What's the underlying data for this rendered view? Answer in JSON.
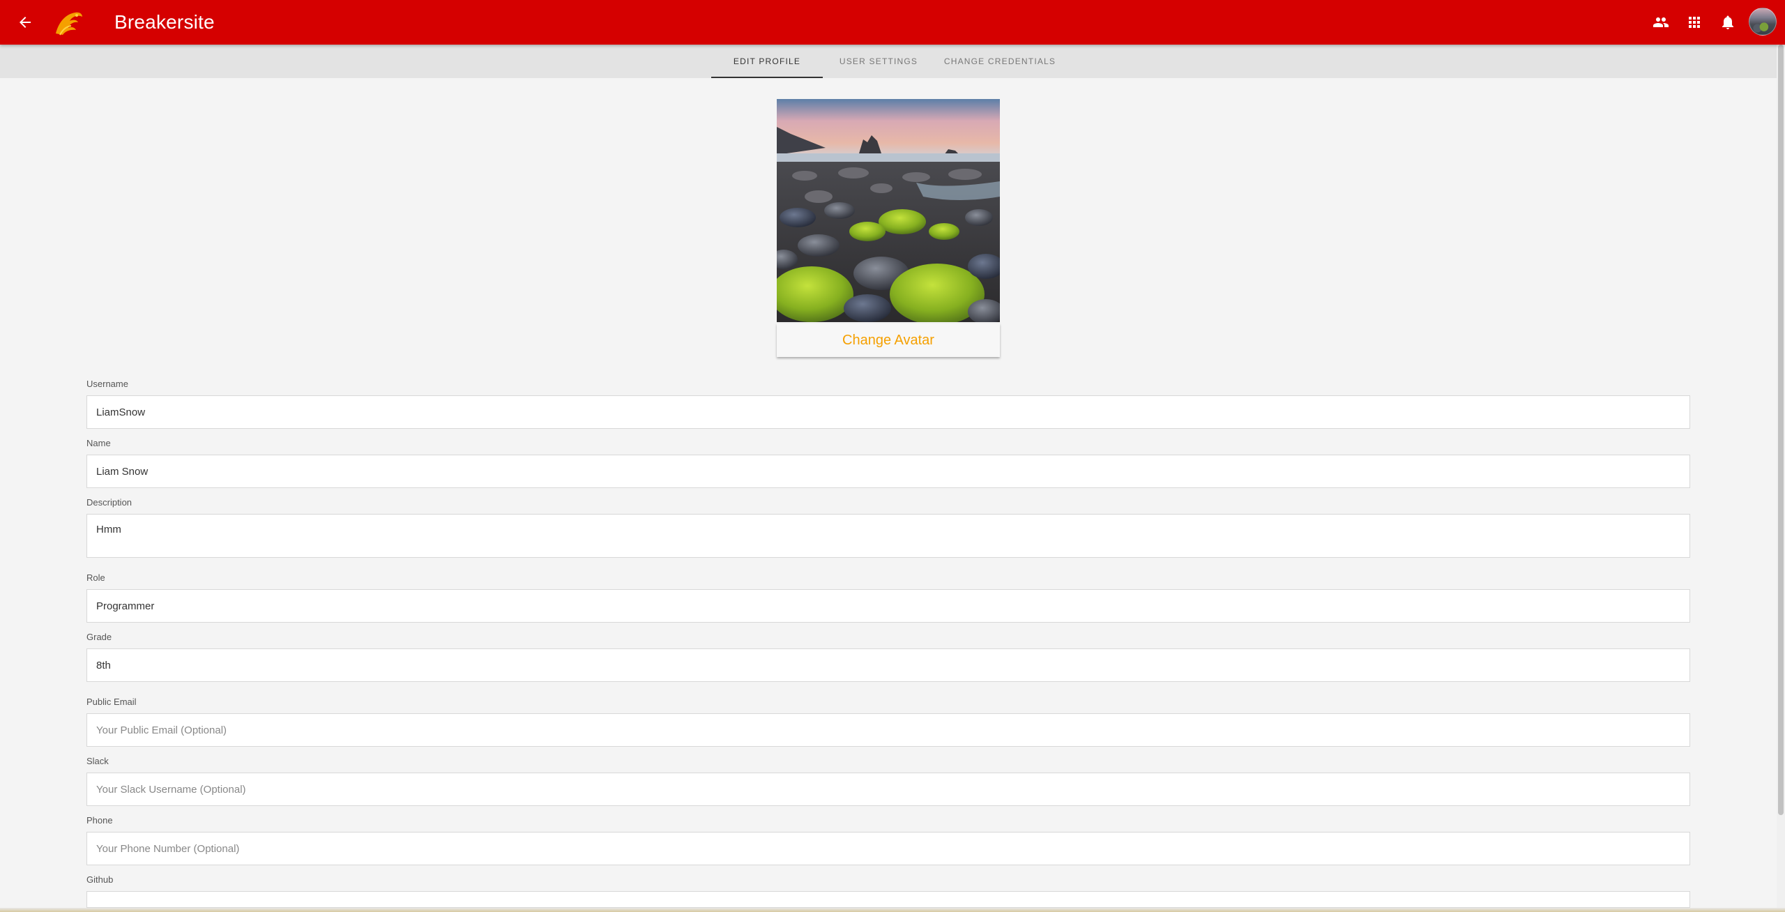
{
  "app": {
    "title": "Breakersite"
  },
  "icons": {
    "back": "arrow-left-icon",
    "logo": "breaker-wave-logo",
    "people": "people-icon",
    "apps": "apps-grid-icon",
    "notifications": "bell-icon",
    "avatar": "user-avatar"
  },
  "colors": {
    "appbar": "#d50000",
    "accent": "#f5a000"
  },
  "tabs": [
    {
      "label": "EDIT PROFILE",
      "active": true
    },
    {
      "label": "USER SETTINGS",
      "active": false
    },
    {
      "label": "CHANGE CREDENTIALS",
      "active": false
    }
  ],
  "avatar": {
    "button_label": "Change Avatar"
  },
  "form": {
    "username": {
      "label": "Username",
      "value": "LiamSnow",
      "placeholder": ""
    },
    "name": {
      "label": "Name",
      "value": "Liam Snow",
      "placeholder": ""
    },
    "description": {
      "label": "Description",
      "value": "Hmm",
      "placeholder": ""
    },
    "role": {
      "label": "Role",
      "value": "Programmer",
      "placeholder": ""
    },
    "grade": {
      "label": "Grade",
      "value": "8th",
      "placeholder": ""
    },
    "public_email": {
      "label": "Public Email",
      "value": "",
      "placeholder": "Your Public Email (Optional)"
    },
    "slack": {
      "label": "Slack",
      "value": "",
      "placeholder": "Your Slack Username (Optional)"
    },
    "phone": {
      "label": "Phone",
      "value": "",
      "placeholder": "Your Phone Number (Optional)"
    },
    "github": {
      "label": "Github",
      "value": "",
      "placeholder": ""
    }
  }
}
